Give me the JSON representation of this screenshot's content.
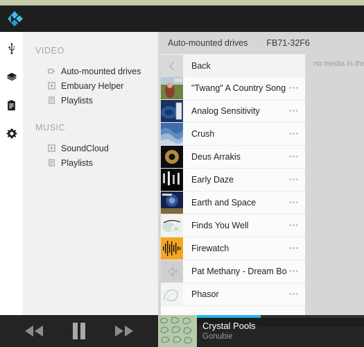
{
  "window": {
    "top_strip_color": "#c5caa8",
    "header_bg": "#1e1e1e",
    "accent_color": "#1fb8ef",
    "logo_name": "kodi-logo"
  },
  "rail": {
    "items": [
      {
        "icon": "usb-icon",
        "name": "usb"
      },
      {
        "icon": "layers-icon",
        "name": "layers"
      },
      {
        "icon": "clipboard-icon",
        "name": "clipboard"
      },
      {
        "icon": "gear-icon",
        "name": "settings"
      }
    ]
  },
  "sidebar": {
    "groups": [
      {
        "title": "VIDEO",
        "items": [
          {
            "label": "Auto-mounted drives",
            "icon": "media-source-icon"
          },
          {
            "label": "Embuary Helper",
            "icon": "addon-icon"
          },
          {
            "label": "Playlists",
            "icon": "playlist-icon"
          }
        ]
      },
      {
        "title": "MUSIC",
        "items": [
          {
            "label": "SoundCloud",
            "icon": "addon-icon"
          },
          {
            "label": "Playlists",
            "icon": "playlist-icon"
          }
        ]
      }
    ]
  },
  "breadcrumb": {
    "first": "Auto-mounted drives",
    "second": "FB71-32F6"
  },
  "file_list": {
    "back_label": "Back",
    "back_icon": "chevron-left-icon",
    "more_glyph": "•••",
    "items": [
      {
        "label": "\"Twang\" A Country Song",
        "art": "twang"
      },
      {
        "label": "Analog Sensitivity",
        "art": "analog"
      },
      {
        "label": "Crush",
        "art": "crush"
      },
      {
        "label": "Deus Arrakis",
        "art": "deus"
      },
      {
        "label": "Early Daze",
        "art": "early"
      },
      {
        "label": "Earth and Space",
        "art": "earth"
      },
      {
        "label": "Finds You Well",
        "art": "finds"
      },
      {
        "label": "Firewatch",
        "art": "firewatch"
      },
      {
        "label": "Pat Methany - Dream Box",
        "art": "placeholder"
      },
      {
        "label": "Phasor",
        "art": "phasor"
      }
    ]
  },
  "info_panel": {
    "message": "no media in this"
  },
  "player": {
    "rewind_icon": "rewind-icon",
    "pause_icon": "pause-icon",
    "forward_icon": "fast-forward-icon",
    "track_title": "Crystal Pools",
    "artist": "Gonubie",
    "progress_percent": 38
  }
}
